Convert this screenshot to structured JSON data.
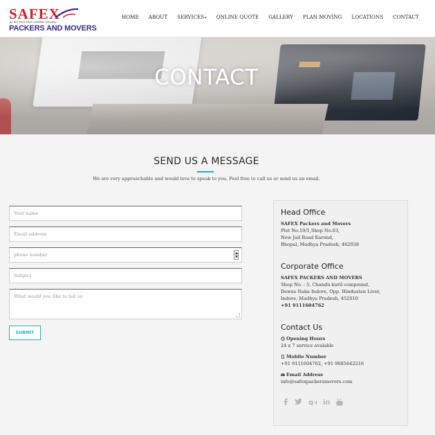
{
  "logo": {
    "brand": "SAFEX",
    "tagline": "An ISO 9001:2015 Certified Company",
    "subtitle": "PACKERS AND MOVERS"
  },
  "nav": {
    "items": [
      "HOME",
      "ABOUT",
      "SERVICES",
      "ONLINE QUOTE",
      "GALLERY",
      "PLAN MOVING",
      "LOCATIONS",
      "CONTACT"
    ]
  },
  "banner": {
    "title": "CONTACT"
  },
  "section": {
    "title": "SEND US A MESSAGE",
    "description": "We are very approachable and would love to speak to you, Feel free to call us or send us an email."
  },
  "form": {
    "name_placeholder": "Your name",
    "email_placeholder": "Email address",
    "phone_placeholder": "phone number",
    "subject_placeholder": "Subject",
    "message_placeholder": "What would you like to tell us",
    "submit_label": "SUBMIT"
  },
  "head_office": {
    "title": "Head Office",
    "company": "SAFEX Packers and Movers",
    "line1": "Plot No.19/1,Shop No.03,",
    "line2": "New Jail Road Karond,",
    "line3": "Bhopal, Madhya Pradesh, 462038"
  },
  "corporate_office": {
    "title": "Corporate Office",
    "company": "SAFEX PACKERS AND MOVERS",
    "line1": "Shop No. : 5, Chandu kuril compound,",
    "line2": "Dewas Naka Indore, Opp. Hindustan Liver,",
    "line3": "Indore, Madhya Pradesh, 452010",
    "phone": "+91 9111604762"
  },
  "contact_us": {
    "title": "Contact Us",
    "hours_label": "Opening Hours",
    "hours_value": "24 x 7 service avalable",
    "mobile_label": "Mobile Number",
    "mobile_value": "+91 9111604762, +91 9685642216",
    "email_label": "Email Address",
    "email_value": "info@safexpackersmovers.com"
  },
  "social": [
    "facebook-icon",
    "twitter-icon",
    "google-plus-icon",
    "linkedin-icon",
    "youtube-icon"
  ],
  "colors": {
    "brand_red": "#c8222b",
    "brand_purple": "#3b2a86",
    "accent": "#2aa9c9"
  }
}
